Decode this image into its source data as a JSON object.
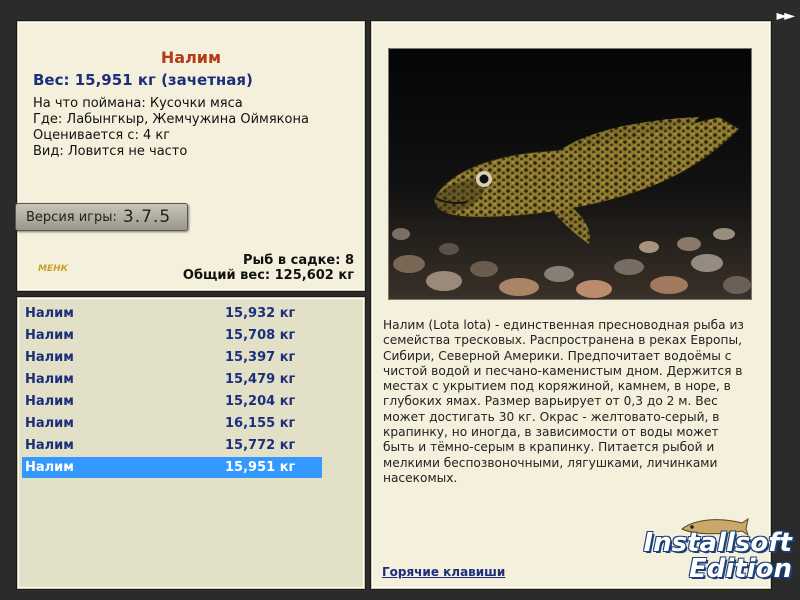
{
  "nav": {
    "forward_label": "►►"
  },
  "info": {
    "name": "Налим",
    "weight": "Вес: 15,951 кг (зачетная)",
    "bait": "На что поймана: Кусочки мяса",
    "location": "Где: Лабынгкыр, Жемчужина Оймякона",
    "value": "Оценивается с: 4 кг",
    "rarity": "Вид: Ловится не часто",
    "version_label": "Версия игры:",
    "version_number": "3.7.5",
    "logo_text": "МЕНК",
    "fish_in_net": "Рыб в садке: 8",
    "total_weight": "Общий вес: 125,602 кг"
  },
  "catch_list": [
    {
      "name": "Налим",
      "weight": "15,932 кг"
    },
    {
      "name": "Налим",
      "weight": "15,708 кг"
    },
    {
      "name": "Налим",
      "weight": "15,397 кг"
    },
    {
      "name": "Налим",
      "weight": "15,479 кг"
    },
    {
      "name": "Налим",
      "weight": "15,204 кг"
    },
    {
      "name": "Налим",
      "weight": "16,155 кг"
    },
    {
      "name": "Налим",
      "weight": "15,772 кг"
    },
    {
      "name": "Налим",
      "weight": "15,951 кг",
      "selected": true
    }
  ],
  "description": "Налим (Lota lota) - единственная пресноводная рыба из семейства тресковых. Распространена в реках Европы, Сибири, Северной Америки. Предпочитает водоёмы с чистой водой и песчано-каменистым дном. Держится в местах с укрытием под коряжиной, камнем, в норе, в глубоких ямах. Размер варьирует от 0,3 до 2 м. Вес может достигать 30 кг. Окрас - желтовато-серый, в крапинку, но иногда, в зависимости от воды может быть и тёмно-серым в крапинку. Питается рыбой и мелкими беспозвоночными, лягушками, личинками насекомых.",
  "hotkeys_label": "Горячие клавиши",
  "brand": {
    "line1": "Installsoft",
    "line2": "Edition"
  },
  "colors": {
    "accent_title": "#b43b16",
    "text_blue": "#1c2f7d",
    "selection": "#3399ff",
    "panel_bg": "#f4f0dc"
  }
}
